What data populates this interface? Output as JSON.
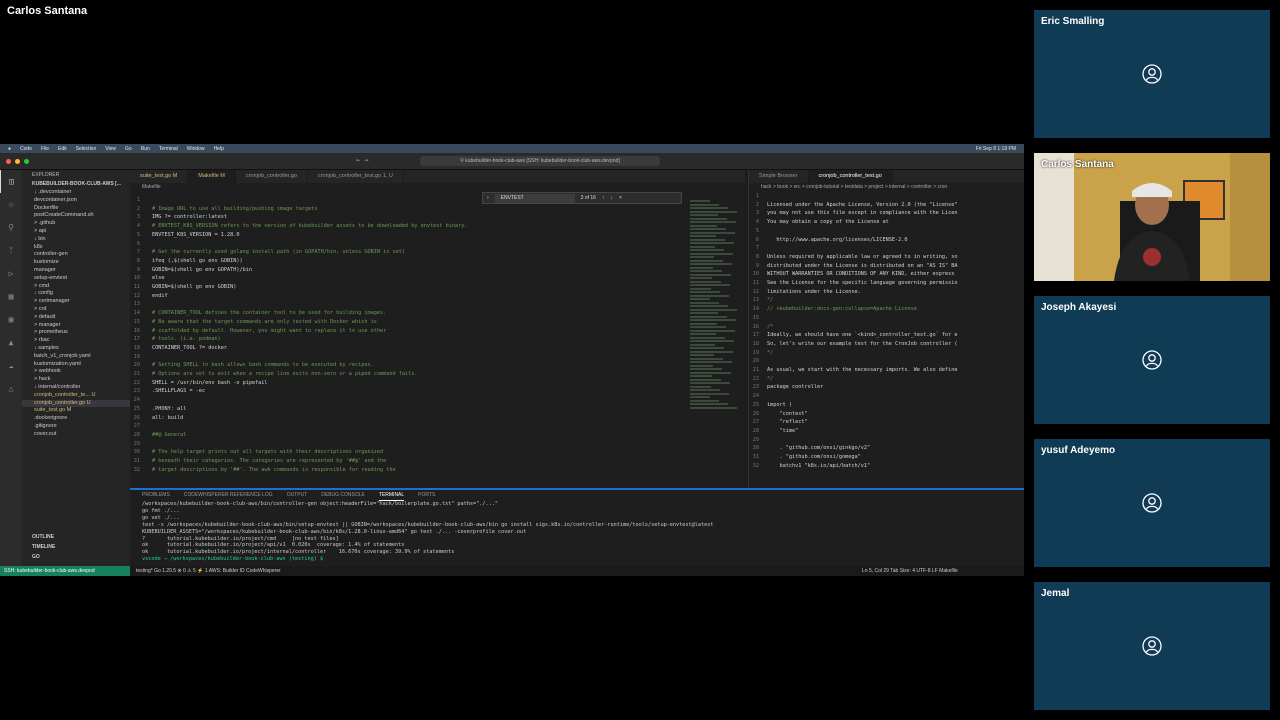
{
  "presenter": {
    "name": "Carlos Santana"
  },
  "mac_menubar": {
    "items": [
      "Code",
      "File",
      "Edit",
      "Selection",
      "View",
      "Go",
      "Run",
      "Terminal",
      "Window",
      "Help"
    ],
    "datetime": "Fri Sep 8 1:18 PM"
  },
  "window": {
    "search_text": "kubebuilder-book-club-aws [SSH: kubebuilder-book-club-aws.devpod]"
  },
  "sidebar": {
    "title": "EXPLORER",
    "project": "KUBEBUILDER-BOOK-CLUB-AWS [...",
    "items": [
      "↓ .devcontainer",
      "  devcontainer.json",
      "  Dockerfile",
      "  postCreateCommand.sh",
      "> .github",
      "> api",
      "↓ bin",
      "  k8s",
      "  controller-gen",
      "  kustomize",
      "  manager",
      "  setup-envtest",
      "> cmd",
      "↓ config",
      "  > certmanager",
      "  > crd",
      "  > default",
      "  > manager",
      "  > prometheus",
      "  > rbac",
      "  ↓ samples",
      "     batch_v1_cronjob.yaml",
      "     kustomization.yaml",
      "  > webhook",
      "> hack",
      "↓ internal/controller",
      "  cronjob_controller_te...  U",
      "  cronjob_controller.go  U",
      "  suite_test.go  M",
      ".dockerignore",
      ".gitignore",
      "cover.out"
    ],
    "bottom": [
      "OUTLINE",
      "TIMELINE",
      "GO"
    ]
  },
  "editor": {
    "tabs": [
      "suite_test.go M",
      "Makefile M",
      "cronjob_controller.go",
      "cronjob_controller_test.go 1, U"
    ],
    "breadcrumb": "Makefile",
    "find": {
      "query": "ENVTEST",
      "count": "3 of 16"
    },
    "lines": [
      "",
      "# Image URL to use all building/pushing image targets",
      "IMG ?= controller:latest",
      "# ENVTEST_K8S_VERSION refers to the version of kubebuilder assets to be downloaded by envtest binary.",
      "ENVTEST_K8S_VERSION = 1.28.0",
      "",
      "# Get the currently used golang install path (in GOPATH/bin, unless GOBIN is set)",
      "ifeq (,$(shell go env GOBIN))",
      "GOBIN=$(shell go env GOPATH)/bin",
      "else",
      "GOBIN=$(shell go env GOBIN)",
      "endif",
      "",
      "# CONTAINER_TOOL defines the container tool to be used for building images.",
      "# Be aware that the target commands are only tested with Docker which is",
      "# scaffolded by default. However, you might want to replace it to use other",
      "# tools. (i.e. podman)",
      "CONTAINER_TOOL ?= docker",
      "",
      "# Setting SHELL to bash allows bash commands to be executed by recipes.",
      "# Options are set to exit when a recipe line exits non-zero or a piped command fails.",
      "SHELL = /usr/bin/env bash -o pipefail",
      ".SHELLFLAGS = -ec",
      "",
      ".PHONY: all",
      "all: build",
      "",
      "##@ General",
      "",
      "# The help target prints out all targets with their descriptions organized",
      "# beneath their categories. The categories are represented by '##@' and the",
      "# target descriptions by '##'. The awk commands is responsible for reading the"
    ]
  },
  "editor2": {
    "tabs": [
      "Simple Browser",
      "cronjob_controller_test.go"
    ],
    "breadcrumb": "hack > book > src > cronjob-tutorial > testdata > project > internal > controller > cron",
    "lines": [
      "",
      "Licensed under the Apache License, Version 2.0 (the \"License\"",
      "you may not use this file except in compliance with the Licen",
      "You may obtain a copy of the License at",
      "",
      "   http://www.apache.org/licenses/LICENSE-2.0",
      "",
      "Unless required by applicable law or agreed to in writing, so",
      "distributed under the License is distributed on an \"AS IS\" BA",
      "WITHOUT WARRANTIES OR CONDITIONS OF ANY KIND, either express",
      "See the License for the specific language governing permissio",
      "limitations under the License.",
      "*/",
      "// +kubebuilder:docs-gen:collapse=Apache License",
      "",
      "/*",
      "Ideally, we should have one `<kind>_controller_test.go` for e",
      "So, let's write our example test for the CronJob controller (",
      "*/",
      "",
      "As usual, we start with the necessary imports. We also define",
      "*/",
      "package controller",
      "",
      "import (",
      "    \"context\"",
      "    \"reflect\"",
      "    \"time\"",
      "",
      "    . \"github.com/onsi/ginkgo/v2\"",
      "    . \"github.com/onsi/gomega\"",
      "    batchv1 \"k8s.io/api/batch/v1\""
    ]
  },
  "panel": {
    "tabs": [
      "PROBLEMS",
      "CODEWHISPERER REFERENCE LOG",
      "OUTPUT",
      "DEBUG CONSOLE",
      "TERMINAL",
      "PORTS"
    ],
    "terminal_lines": [
      "/workspaces/kubebuilder-book-club-aws/bin/controller-gen object:headerFile=\"hack/boilerplate.go.txt\" paths=\"./...\"",
      "go fmt ./...",
      "go vet ./...",
      "test -s /workspaces/kubebuilder-book-club-aws/bin/setup-envtest || GOBIN=/workspaces/kubebuilder-book-club-aws/bin go install sigs.k8s.io/controller-runtime/tools/setup-envtest@latest",
      "KUBEBUILDER_ASSETS=\"/workspaces/kubebuilder-book-club-aws/bin/k8s/1.28.0-linux-amd64\" go test ./... -coverprofile cover.out",
      "?       tutorial.kubebuilder.io/project/cmd     [no test files]",
      "ok      tutorial.kubebuilder.io/project/api/v1  0.020s  coverage: 1.4% of statements",
      "ok      tutorial.kubebuilder.io/project/internal/controller    16.670s coverage: 39.9% of statements",
      "vscode → /workspaces/kubebuilder-book-club-aws (testing) $ "
    ]
  },
  "statusbar": {
    "remote": "SSH: kubebuilder-book-club-aws.devpod",
    "left": "testing*   Go 1.20.5   ⊗ 0 ⚠ 5   ⚡ 1   AWS: Builder ID   CodeWhisperer",
    "right": "Ln 5, Col 29   Tab Size: 4   UTF-8   LF   Makefile"
  },
  "participants": [
    {
      "name": "Eric Smalling",
      "has_video": false
    },
    {
      "name": "Carlos Santana",
      "has_video": true
    },
    {
      "name": "Joseph Akayesi",
      "has_video": false
    },
    {
      "name": "yusuf Adeyemo",
      "has_video": false
    },
    {
      "name": "Jemal",
      "has_video": false
    }
  ],
  "colors": {
    "tile_bg": "#0f3b55",
    "accent": "#1f6fd0",
    "remote": "#16825d"
  }
}
